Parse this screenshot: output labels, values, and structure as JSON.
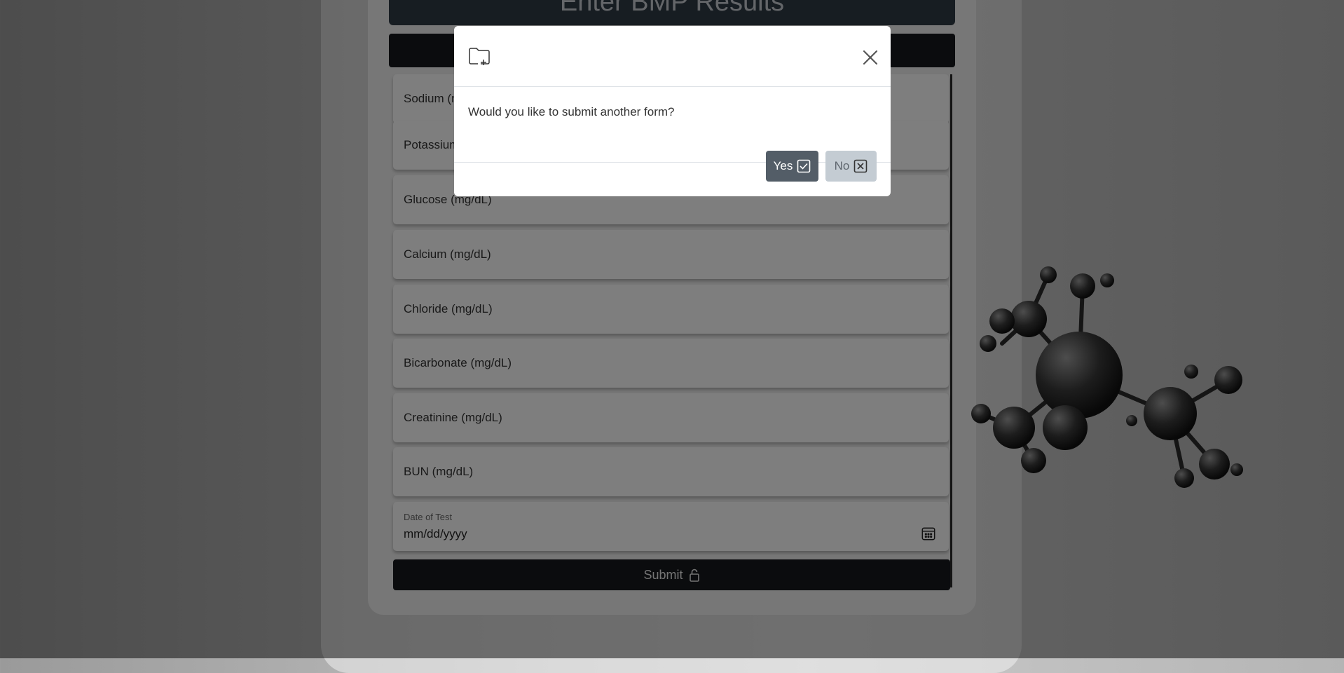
{
  "form": {
    "title": "Enter BMP Results",
    "fields": [
      {
        "label": "Sodium (mg/dL)"
      },
      {
        "label": "Potassium (mg/dL)"
      },
      {
        "label": "Glucose (mg/dL)"
      },
      {
        "label": "Calcium (mg/dL)"
      },
      {
        "label": "Chloride (mg/dL)"
      },
      {
        "label": "Bicarbonate (mg/dL)"
      },
      {
        "label": "Creatinine (mg/dL)"
      },
      {
        "label": "BUN (mg/dL)"
      }
    ],
    "date_field": {
      "label": "Date of Test",
      "placeholder": "mm/dd/yyyy"
    },
    "submit_label": "Submit"
  },
  "modal": {
    "message": "Would you like to submit another form?",
    "yes_label": "Yes",
    "no_label": "No"
  },
  "icons": {
    "header": "folder-plus-icon",
    "close": "close-icon",
    "yes": "check-square-icon",
    "no": "x-square-icon",
    "submit": "lock-icon",
    "date": "calendar-icon"
  },
  "colors": {
    "yes_button": "#535d67",
    "no_button": "#c4ccd3",
    "header_bar": "#2f3a44",
    "submit_button": "#16191d"
  }
}
